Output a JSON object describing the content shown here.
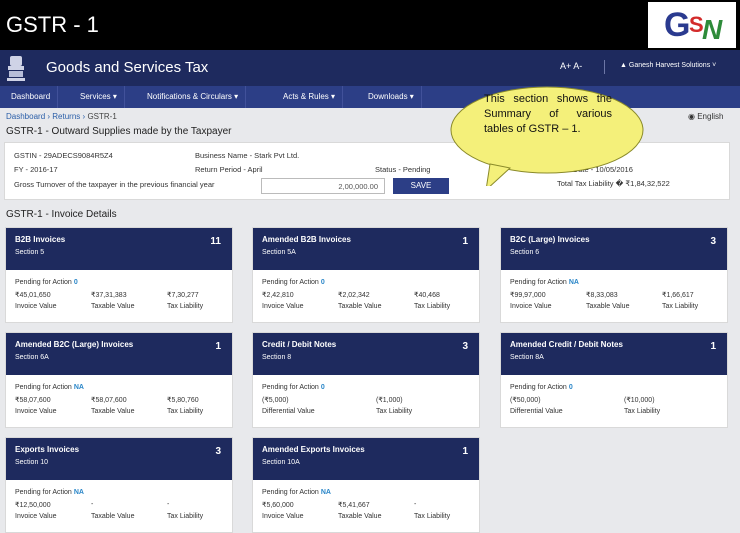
{
  "slide": {
    "title": "GSTR - 1",
    "logo_letters": [
      "G",
      "S",
      "N"
    ]
  },
  "portal": {
    "title": "Goods and Services Tax",
    "font_controls": "A+   A-",
    "user": "▲ Ganesh Harvest Solutions ˅"
  },
  "nav": [
    {
      "label": "Dashboard"
    },
    {
      "label": "Services ▾"
    },
    {
      "label": "Notifications & Circulars ▾"
    },
    {
      "label": "Acts & Rules ▾"
    },
    {
      "label": "Downloads ▾"
    }
  ],
  "breadcrumb": {
    "items": [
      "Dashboard",
      "Returns"
    ],
    "sep": "›",
    "current": "GSTR-1"
  },
  "language": "◉ English",
  "outward": {
    "title": "GSTR-1 - Outward Supplies made by the Taxpayer",
    "gstin": "GSTIN - 29ADECS9084R5Z4",
    "business": "Business Name - Stark Pvt Ltd.",
    "fy": "FY - 2016-17",
    "period": "Return Period - April",
    "status": "Status - Pending",
    "due_date": "Due Date - 10/05/2016",
    "turnover_label": "Gross Turnover of the taxpayer in the previous financial year",
    "turnover_value": "2,00,000.00",
    "save": "SAVE",
    "tax_liability": "Total Tax Liability � ₹1,84,32,522"
  },
  "invoice_title": "GSTR-1 - Invoice Details",
  "cards": [
    {
      "title": "B2B Invoices",
      "section": "Section 5",
      "count": "11",
      "pending": "0",
      "values": [
        "₹45,01,650",
        "₹37,31,383",
        "₹7,30,277"
      ],
      "labels": [
        "Invoice Value",
        "Taxable Value",
        "Tax Liability"
      ]
    },
    {
      "title": "Amended B2B Invoices",
      "section": "Section 5A",
      "count": "1",
      "pending": "0",
      "values": [
        "₹2,42,810",
        "₹2,02,342",
        "₹40,468"
      ],
      "labels": [
        "Invoice Value",
        "Taxable Value",
        "Tax Liability"
      ]
    },
    {
      "title": "B2C (Large) Invoices",
      "section": "Section 6",
      "count": "3",
      "pending": "NA",
      "values": [
        "₹99,97,000",
        "₹8,33,083",
        "₹1,66,617"
      ],
      "labels": [
        "Invoice Value",
        "Taxable Value",
        "Tax Liability"
      ]
    },
    {
      "title": "Amended B2C (Large) Invoices",
      "section": "Section 6A",
      "count": "1",
      "pending": "NA",
      "values": [
        "₹58,07,600",
        "₹58,07,600",
        "₹5,80,760"
      ],
      "labels": [
        "Invoice Value",
        "Taxable Value",
        "Tax Liability"
      ]
    },
    {
      "title": "Credit / Debit Notes",
      "section": "Section 8",
      "count": "3",
      "pending": "0",
      "values": [
        "(₹5,000)",
        "(₹1,000)"
      ],
      "labels": [
        "Differential Value",
        "Tax Liability"
      ]
    },
    {
      "title": "Amended Credit / Debit Notes",
      "section": "Section 8A",
      "count": "1",
      "pending": "0",
      "values": [
        "(₹50,000)",
        "(₹10,000)"
      ],
      "labels": [
        "Differential Value",
        "Tax Liability"
      ]
    },
    {
      "title": "Exports Invoices",
      "section": "Section 10",
      "count": "3",
      "pending": "NA",
      "values": [
        "₹12,50,000",
        "-",
        "-"
      ],
      "labels": [
        "Invoice Value",
        "Taxable Value",
        "Tax Liability"
      ]
    },
    {
      "title": "Amended Exports Invoices",
      "section": "Section 10A",
      "count": "1",
      "pending": "NA",
      "values": [
        "₹5,60,000",
        "₹5,41,667",
        "-"
      ],
      "labels": [
        "Invoice Value",
        "Taxable Value",
        "Tax Liability"
      ]
    }
  ],
  "pending_label": "Pending for Action",
  "callout": "This section shows the Summary of various tables of GSTR – 1.",
  "colors": {
    "header": "#1e2a5e",
    "nav": "#2c3e86",
    "callout": "#f4f07a"
  }
}
